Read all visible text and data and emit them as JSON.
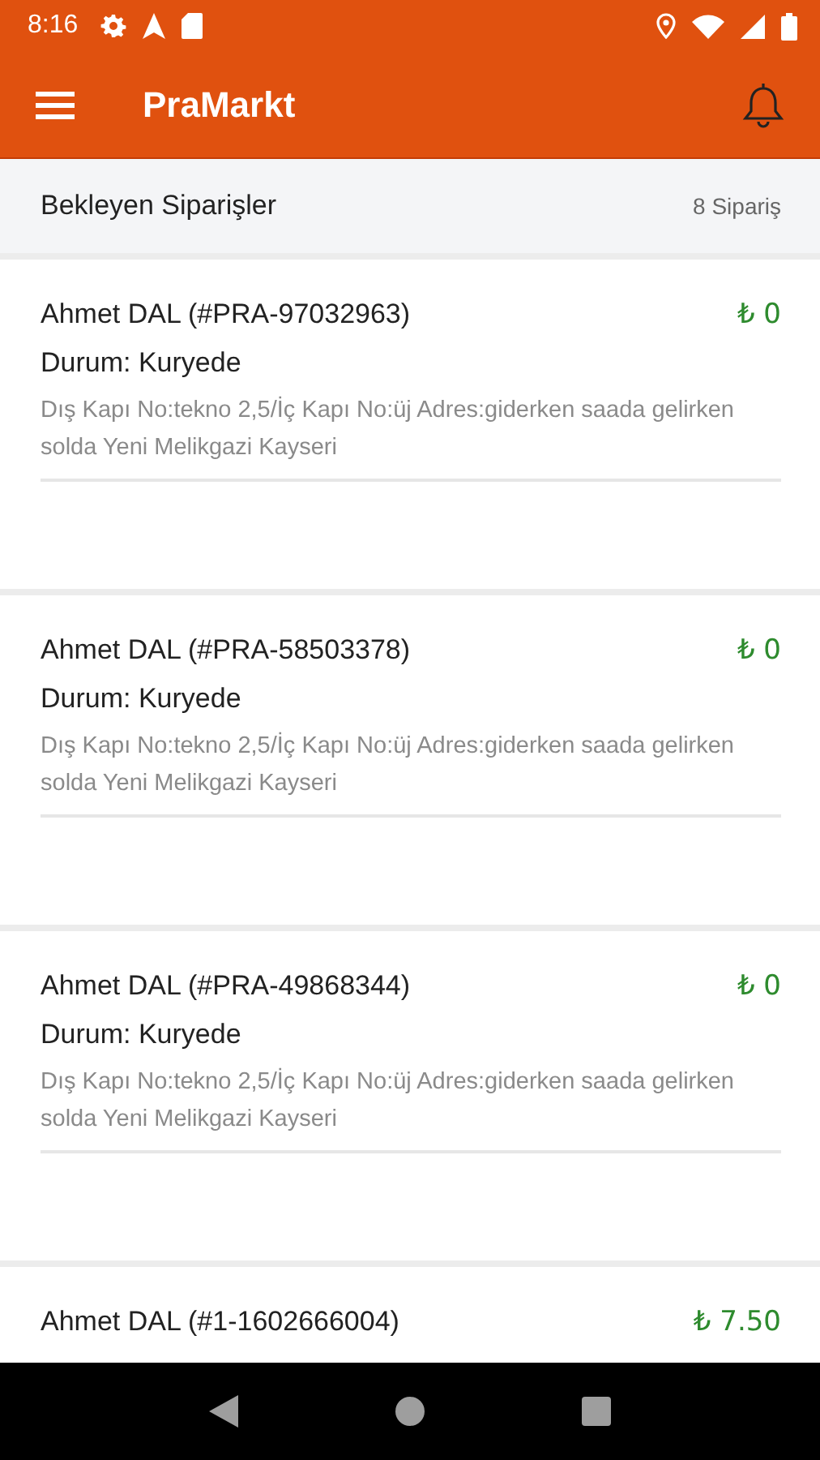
{
  "status_bar": {
    "time": "8:16"
  },
  "app_bar": {
    "title": "PraMarkt"
  },
  "list_header": {
    "title": "Bekleyen Siparişler",
    "count": "8 Sipariş"
  },
  "orders": [
    {
      "title": "Ahmet DAL (#PRA-97032963)",
      "price": "₺ 0",
      "status": "Durum: Kuryede",
      "address": "Dış Kapı No:tekno 2,5/İç Kapı No:üj Adres:giderken saada gelirken solda Yeni Melikgazi Kayseri"
    },
    {
      "title": "Ahmet DAL (#PRA-58503378)",
      "price": "₺ 0",
      "status": "Durum: Kuryede",
      "address": "Dış Kapı No:tekno 2,5/İç Kapı No:üj Adres:giderken saada gelirken solda Yeni Melikgazi Kayseri"
    },
    {
      "title": "Ahmet DAL (#PRA-49868344)",
      "price": "₺ 0",
      "status": "Durum: Kuryede",
      "address": "Dış Kapı No:tekno 2,5/İç Kapı No:üj Adres:giderken saada gelirken solda Yeni Melikgazi Kayseri"
    },
    {
      "title": "Ahmet DAL (#1-1602666004)",
      "price": "₺ 7.50"
    }
  ]
}
